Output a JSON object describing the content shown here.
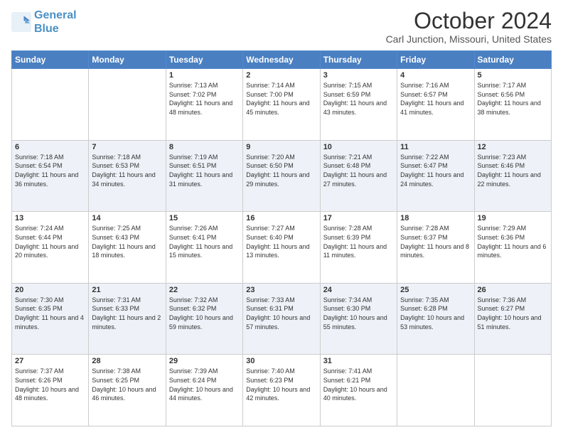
{
  "logo": {
    "line1": "General",
    "line2": "Blue"
  },
  "title": "October 2024",
  "location": "Carl Junction, Missouri, United States",
  "weekdays": [
    "Sunday",
    "Monday",
    "Tuesday",
    "Wednesday",
    "Thursday",
    "Friday",
    "Saturday"
  ],
  "weeks": [
    [
      {
        "day": "",
        "info": ""
      },
      {
        "day": "",
        "info": ""
      },
      {
        "day": "1",
        "info": "Sunrise: 7:13 AM\nSunset: 7:02 PM\nDaylight: 11 hours and 48 minutes."
      },
      {
        "day": "2",
        "info": "Sunrise: 7:14 AM\nSunset: 7:00 PM\nDaylight: 11 hours and 45 minutes."
      },
      {
        "day": "3",
        "info": "Sunrise: 7:15 AM\nSunset: 6:59 PM\nDaylight: 11 hours and 43 minutes."
      },
      {
        "day": "4",
        "info": "Sunrise: 7:16 AM\nSunset: 6:57 PM\nDaylight: 11 hours and 41 minutes."
      },
      {
        "day": "5",
        "info": "Sunrise: 7:17 AM\nSunset: 6:56 PM\nDaylight: 11 hours and 38 minutes."
      }
    ],
    [
      {
        "day": "6",
        "info": "Sunrise: 7:18 AM\nSunset: 6:54 PM\nDaylight: 11 hours and 36 minutes."
      },
      {
        "day": "7",
        "info": "Sunrise: 7:18 AM\nSunset: 6:53 PM\nDaylight: 11 hours and 34 minutes."
      },
      {
        "day": "8",
        "info": "Sunrise: 7:19 AM\nSunset: 6:51 PM\nDaylight: 11 hours and 31 minutes."
      },
      {
        "day": "9",
        "info": "Sunrise: 7:20 AM\nSunset: 6:50 PM\nDaylight: 11 hours and 29 minutes."
      },
      {
        "day": "10",
        "info": "Sunrise: 7:21 AM\nSunset: 6:48 PM\nDaylight: 11 hours and 27 minutes."
      },
      {
        "day": "11",
        "info": "Sunrise: 7:22 AM\nSunset: 6:47 PM\nDaylight: 11 hours and 24 minutes."
      },
      {
        "day": "12",
        "info": "Sunrise: 7:23 AM\nSunset: 6:46 PM\nDaylight: 11 hours and 22 minutes."
      }
    ],
    [
      {
        "day": "13",
        "info": "Sunrise: 7:24 AM\nSunset: 6:44 PM\nDaylight: 11 hours and 20 minutes."
      },
      {
        "day": "14",
        "info": "Sunrise: 7:25 AM\nSunset: 6:43 PM\nDaylight: 11 hours and 18 minutes."
      },
      {
        "day": "15",
        "info": "Sunrise: 7:26 AM\nSunset: 6:41 PM\nDaylight: 11 hours and 15 minutes."
      },
      {
        "day": "16",
        "info": "Sunrise: 7:27 AM\nSunset: 6:40 PM\nDaylight: 11 hours and 13 minutes."
      },
      {
        "day": "17",
        "info": "Sunrise: 7:28 AM\nSunset: 6:39 PM\nDaylight: 11 hours and 11 minutes."
      },
      {
        "day": "18",
        "info": "Sunrise: 7:28 AM\nSunset: 6:37 PM\nDaylight: 11 hours and 8 minutes."
      },
      {
        "day": "19",
        "info": "Sunrise: 7:29 AM\nSunset: 6:36 PM\nDaylight: 11 hours and 6 minutes."
      }
    ],
    [
      {
        "day": "20",
        "info": "Sunrise: 7:30 AM\nSunset: 6:35 PM\nDaylight: 11 hours and 4 minutes."
      },
      {
        "day": "21",
        "info": "Sunrise: 7:31 AM\nSunset: 6:33 PM\nDaylight: 11 hours and 2 minutes."
      },
      {
        "day": "22",
        "info": "Sunrise: 7:32 AM\nSunset: 6:32 PM\nDaylight: 10 hours and 59 minutes."
      },
      {
        "day": "23",
        "info": "Sunrise: 7:33 AM\nSunset: 6:31 PM\nDaylight: 10 hours and 57 minutes."
      },
      {
        "day": "24",
        "info": "Sunrise: 7:34 AM\nSunset: 6:30 PM\nDaylight: 10 hours and 55 minutes."
      },
      {
        "day": "25",
        "info": "Sunrise: 7:35 AM\nSunset: 6:28 PM\nDaylight: 10 hours and 53 minutes."
      },
      {
        "day": "26",
        "info": "Sunrise: 7:36 AM\nSunset: 6:27 PM\nDaylight: 10 hours and 51 minutes."
      }
    ],
    [
      {
        "day": "27",
        "info": "Sunrise: 7:37 AM\nSunset: 6:26 PM\nDaylight: 10 hours and 48 minutes."
      },
      {
        "day": "28",
        "info": "Sunrise: 7:38 AM\nSunset: 6:25 PM\nDaylight: 10 hours and 46 minutes."
      },
      {
        "day": "29",
        "info": "Sunrise: 7:39 AM\nSunset: 6:24 PM\nDaylight: 10 hours and 44 minutes."
      },
      {
        "day": "30",
        "info": "Sunrise: 7:40 AM\nSunset: 6:23 PM\nDaylight: 10 hours and 42 minutes."
      },
      {
        "day": "31",
        "info": "Sunrise: 7:41 AM\nSunset: 6:21 PM\nDaylight: 10 hours and 40 minutes."
      },
      {
        "day": "",
        "info": ""
      },
      {
        "day": "",
        "info": ""
      }
    ]
  ]
}
